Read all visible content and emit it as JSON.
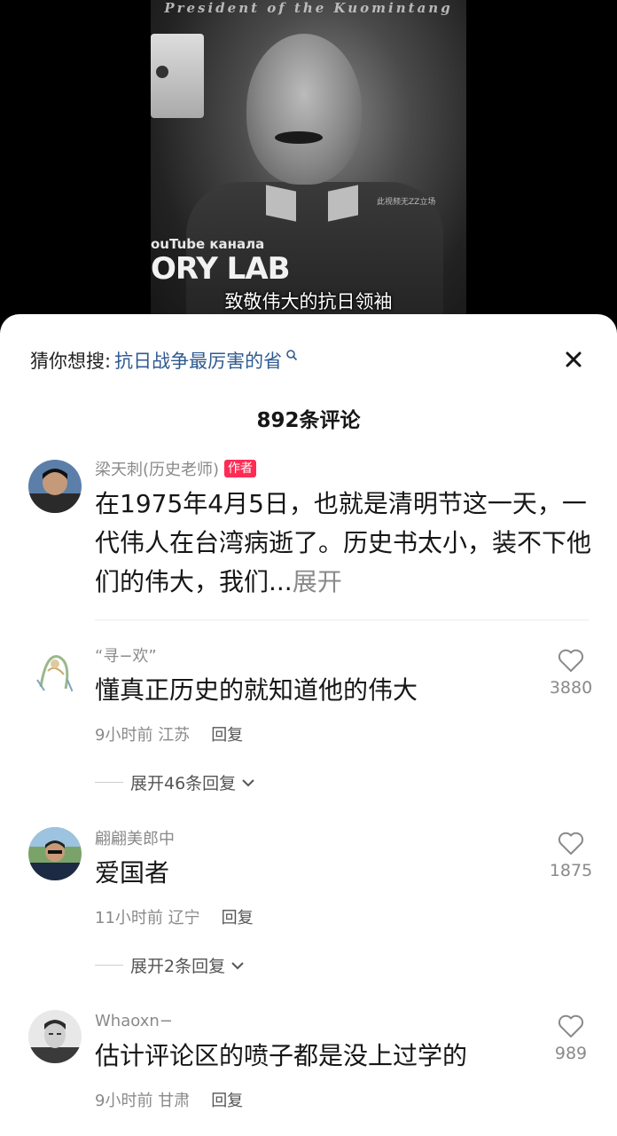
{
  "video": {
    "overlay_title": "President of the Kuomintang",
    "watermark": "此视频无ZZ立场",
    "channel_line": "ouTube канала",
    "lab_text": "ORY LAB",
    "subtitle": "致敬伟大的抗日领袖"
  },
  "search_suggest": {
    "prefix": "猜你想搜:",
    "term": "抗日战争最厉害的省"
  },
  "comments_header": {
    "count_label": "892条评论"
  },
  "comments": [
    {
      "username": "梁天刺(历史老师)",
      "author_tag": "作者",
      "text": "在1975年4月5日，也就是清明节这一天，一代伟人在台湾病逝了。历史书太小，装不下他们的伟大，我们...",
      "expand": "展开"
    },
    {
      "username": "“寻−欢”",
      "text": "懂真正历史的就知道他的伟大",
      "time": "9小时前",
      "location": "江苏",
      "reply": "回复",
      "more_replies": "展开46条回复",
      "likes": "3880"
    },
    {
      "username": "翩翩美郎中",
      "text": "爱国者",
      "time": "11小时前",
      "location": "辽宁",
      "reply": "回复",
      "more_replies": "展开2条回复",
      "likes": "1875"
    },
    {
      "username": "Whaoxn−",
      "text": "估计评论区的喷子都是没上过学的",
      "time": "9小时前",
      "location": "甘肃",
      "reply": "回复",
      "likes": "989"
    }
  ]
}
